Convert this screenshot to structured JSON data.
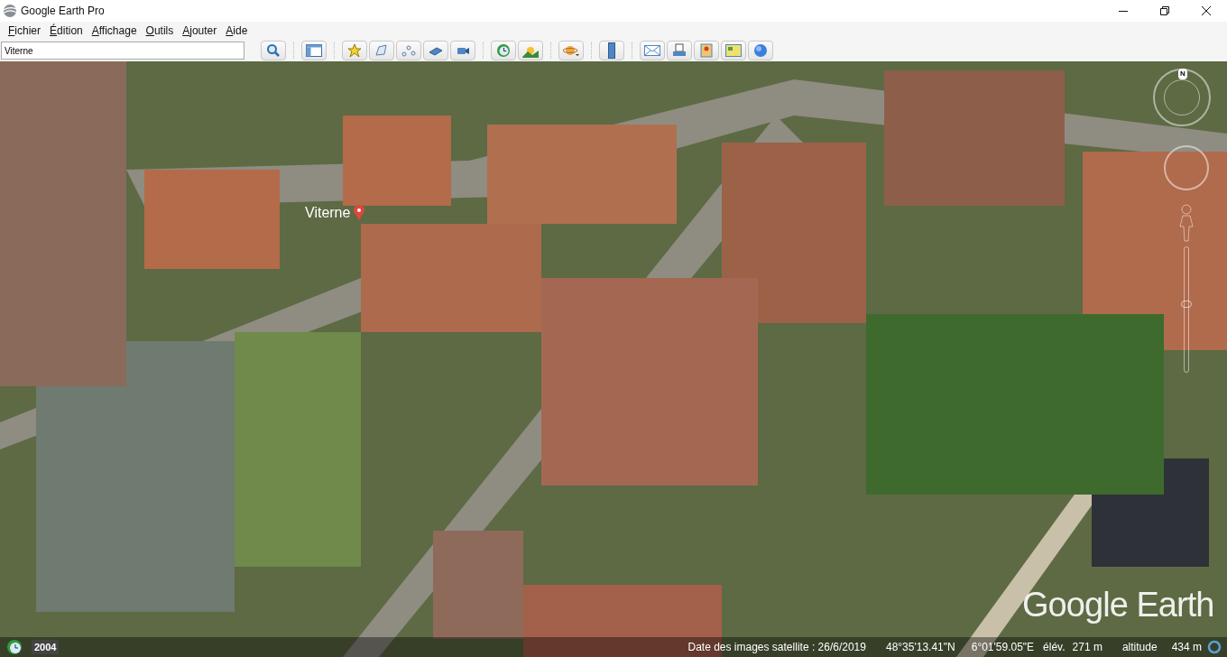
{
  "window": {
    "title": "Google Earth Pro"
  },
  "menu": [
    "Fichier",
    "Édition",
    "Affichage",
    "Outils",
    "Ajouter",
    "Aide"
  ],
  "search": {
    "value": "Viterne"
  },
  "map": {
    "zoom": {
      "level": 0.55
    },
    "place_label": "Viterne",
    "compass_label": "N",
    "imagery_year": "2004",
    "logo": "Google Earth"
  },
  "status_bar": {
    "imagery_date": "Date des images satellite : 26/6/2019",
    "latitude": "48°35'13.41\"N",
    "longitude": "6°01'59.05\"E",
    "elevation_label": "élév.",
    "elevation": "271 m",
    "altitude_label": "altitude",
    "altitude": "434 m"
  }
}
